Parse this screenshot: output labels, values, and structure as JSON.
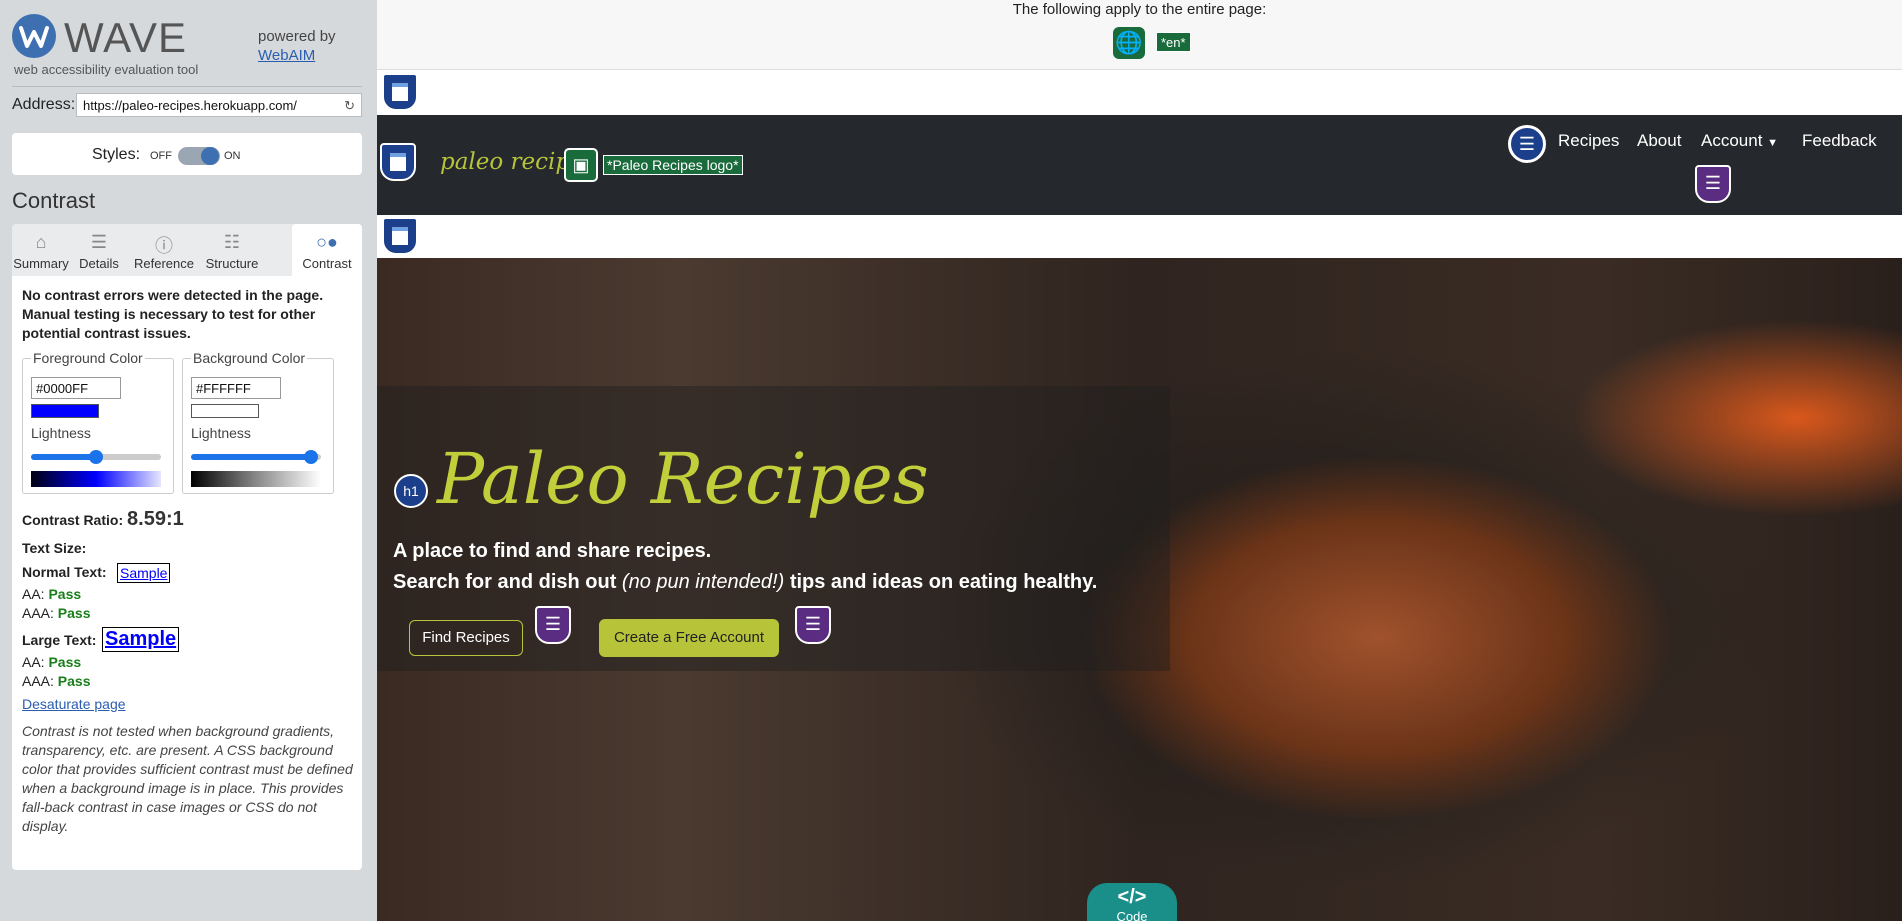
{
  "wave": {
    "brand": "WAVE",
    "tagline": "web accessibility evaluation tool",
    "powered_by": "powered by",
    "webaim": "WebAIM",
    "address_label": "Address:",
    "address_value": "https://paleo-recipes.herokuapp.com/",
    "styles_label": "Styles:",
    "styles_off": "OFF",
    "styles_on": "ON",
    "section_title": "Contrast",
    "tabs": [
      {
        "label": "Summary",
        "icon": "home-icon"
      },
      {
        "label": "Details",
        "icon": "list-icon"
      },
      {
        "label": "Reference",
        "icon": "info-icon"
      },
      {
        "label": "Structure",
        "icon": "structure-icon"
      },
      {
        "label": "Contrast",
        "icon": "contrast-icon"
      }
    ],
    "active_tab": "Contrast",
    "no_errors": "No contrast errors were detected in the page. Manual testing is necessary to test for other potential contrast issues.",
    "foreground": {
      "legend": "Foreground Color",
      "value": "#0000FF",
      "lightness_label": "Lightness",
      "lightness": 0.5,
      "color": "#0000ff"
    },
    "background": {
      "legend": "Background Color",
      "value": "#FFFFFF",
      "lightness_label": "Lightness",
      "lightness": 0.92,
      "color": "#ffffff"
    },
    "ratio_label": "Contrast Ratio:",
    "ratio_value": "8.59:1",
    "text_size_label": "Text Size:",
    "normal_text_label": "Normal Text:",
    "large_text_label": "Large Text:",
    "sample": "Sample",
    "aa_label": "AA:",
    "aaa_label": "AAA:",
    "pass": "Pass",
    "desaturate": "Desaturate page",
    "note": "Contrast is not tested when background gradients, transparency, etc. are present. A CSS background color that provides sufficient contrast must be defined when a background image is in place. This provides fall-back contrast in case images or CSS do not display."
  },
  "page": {
    "apply_text": "The following apply to the entire page:",
    "lang_badge": "*en*",
    "brand": "paleo recipes",
    "logo_alt": "*Paleo Recipes logo*",
    "nav": [
      "Recipes",
      "About",
      "Account",
      "Feedback"
    ],
    "hero_title": "Paleo Recipes",
    "hero_sub1": "A place to find and share recipes.",
    "hero_sub2_a": "Search for and dish out ",
    "hero_sub2_em": "(no pun intended!)",
    "hero_sub2_b": " tips and ideas on eating healthy.",
    "btn_find": "Find Recipes",
    "btn_create": "Create a Free Account",
    "h1_icon": "h1",
    "code_tab_icon": "</>",
    "code_tab_label": "Code"
  }
}
